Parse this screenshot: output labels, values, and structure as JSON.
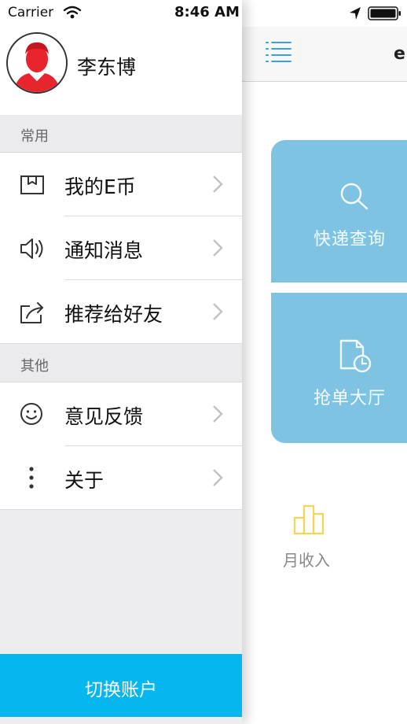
{
  "status_bar": {
    "carrier": "Carrier",
    "time": "8:46 AM",
    "icons": [
      "wifi-icon",
      "location-arrow-icon",
      "battery-icon"
    ]
  },
  "main": {
    "nav_title": "e",
    "menu_icon": "list-menu-icon",
    "tiles": [
      {
        "label": "快递查询",
        "icon": "search-icon"
      },
      {
        "label": "抢单大厅",
        "icon": "document-clock-icon"
      }
    ],
    "income": {
      "label": "月收入",
      "icon": "bar-chart-icon"
    }
  },
  "drawer": {
    "profile": {
      "name": "李东博",
      "avatar_icon": "user-avatar-icon"
    },
    "sections": [
      {
        "title": "常用",
        "items": [
          {
            "label": "我的E币",
            "icon": "box-icon"
          },
          {
            "label": "通知消息",
            "icon": "speaker-icon"
          },
          {
            "label": "推荐给好友",
            "icon": "share-icon"
          }
        ]
      },
      {
        "title": "其他",
        "items": [
          {
            "label": "意见反馈",
            "icon": "smiley-icon"
          },
          {
            "label": "关于",
            "icon": "more-vertical-icon"
          }
        ]
      }
    ],
    "switch_account_label": "切换账户"
  },
  "colors": {
    "accent_blue": "#05b6ef",
    "tile_blue": "#7fc3e3",
    "menu_icon_blue": "#3d9cf0",
    "income_icon_yellow": "#f3d653"
  }
}
